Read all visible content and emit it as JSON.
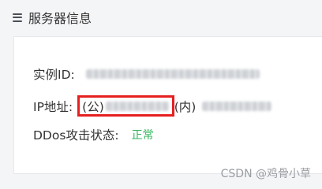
{
  "header": {
    "icon": "list-icon",
    "title": "服务器信息"
  },
  "card": {
    "instance_id": {
      "label": "实例ID:"
    },
    "ip": {
      "label": "IP地址:",
      "public_prefix": "(公)",
      "private_prefix": "(内)",
      "highlight_color": "#e61f1f"
    },
    "ddos": {
      "label": "DDos攻击状态:",
      "status": "正常",
      "status_color": "#2fb55a"
    }
  },
  "watermark": "CSDN @鸡骨小草"
}
